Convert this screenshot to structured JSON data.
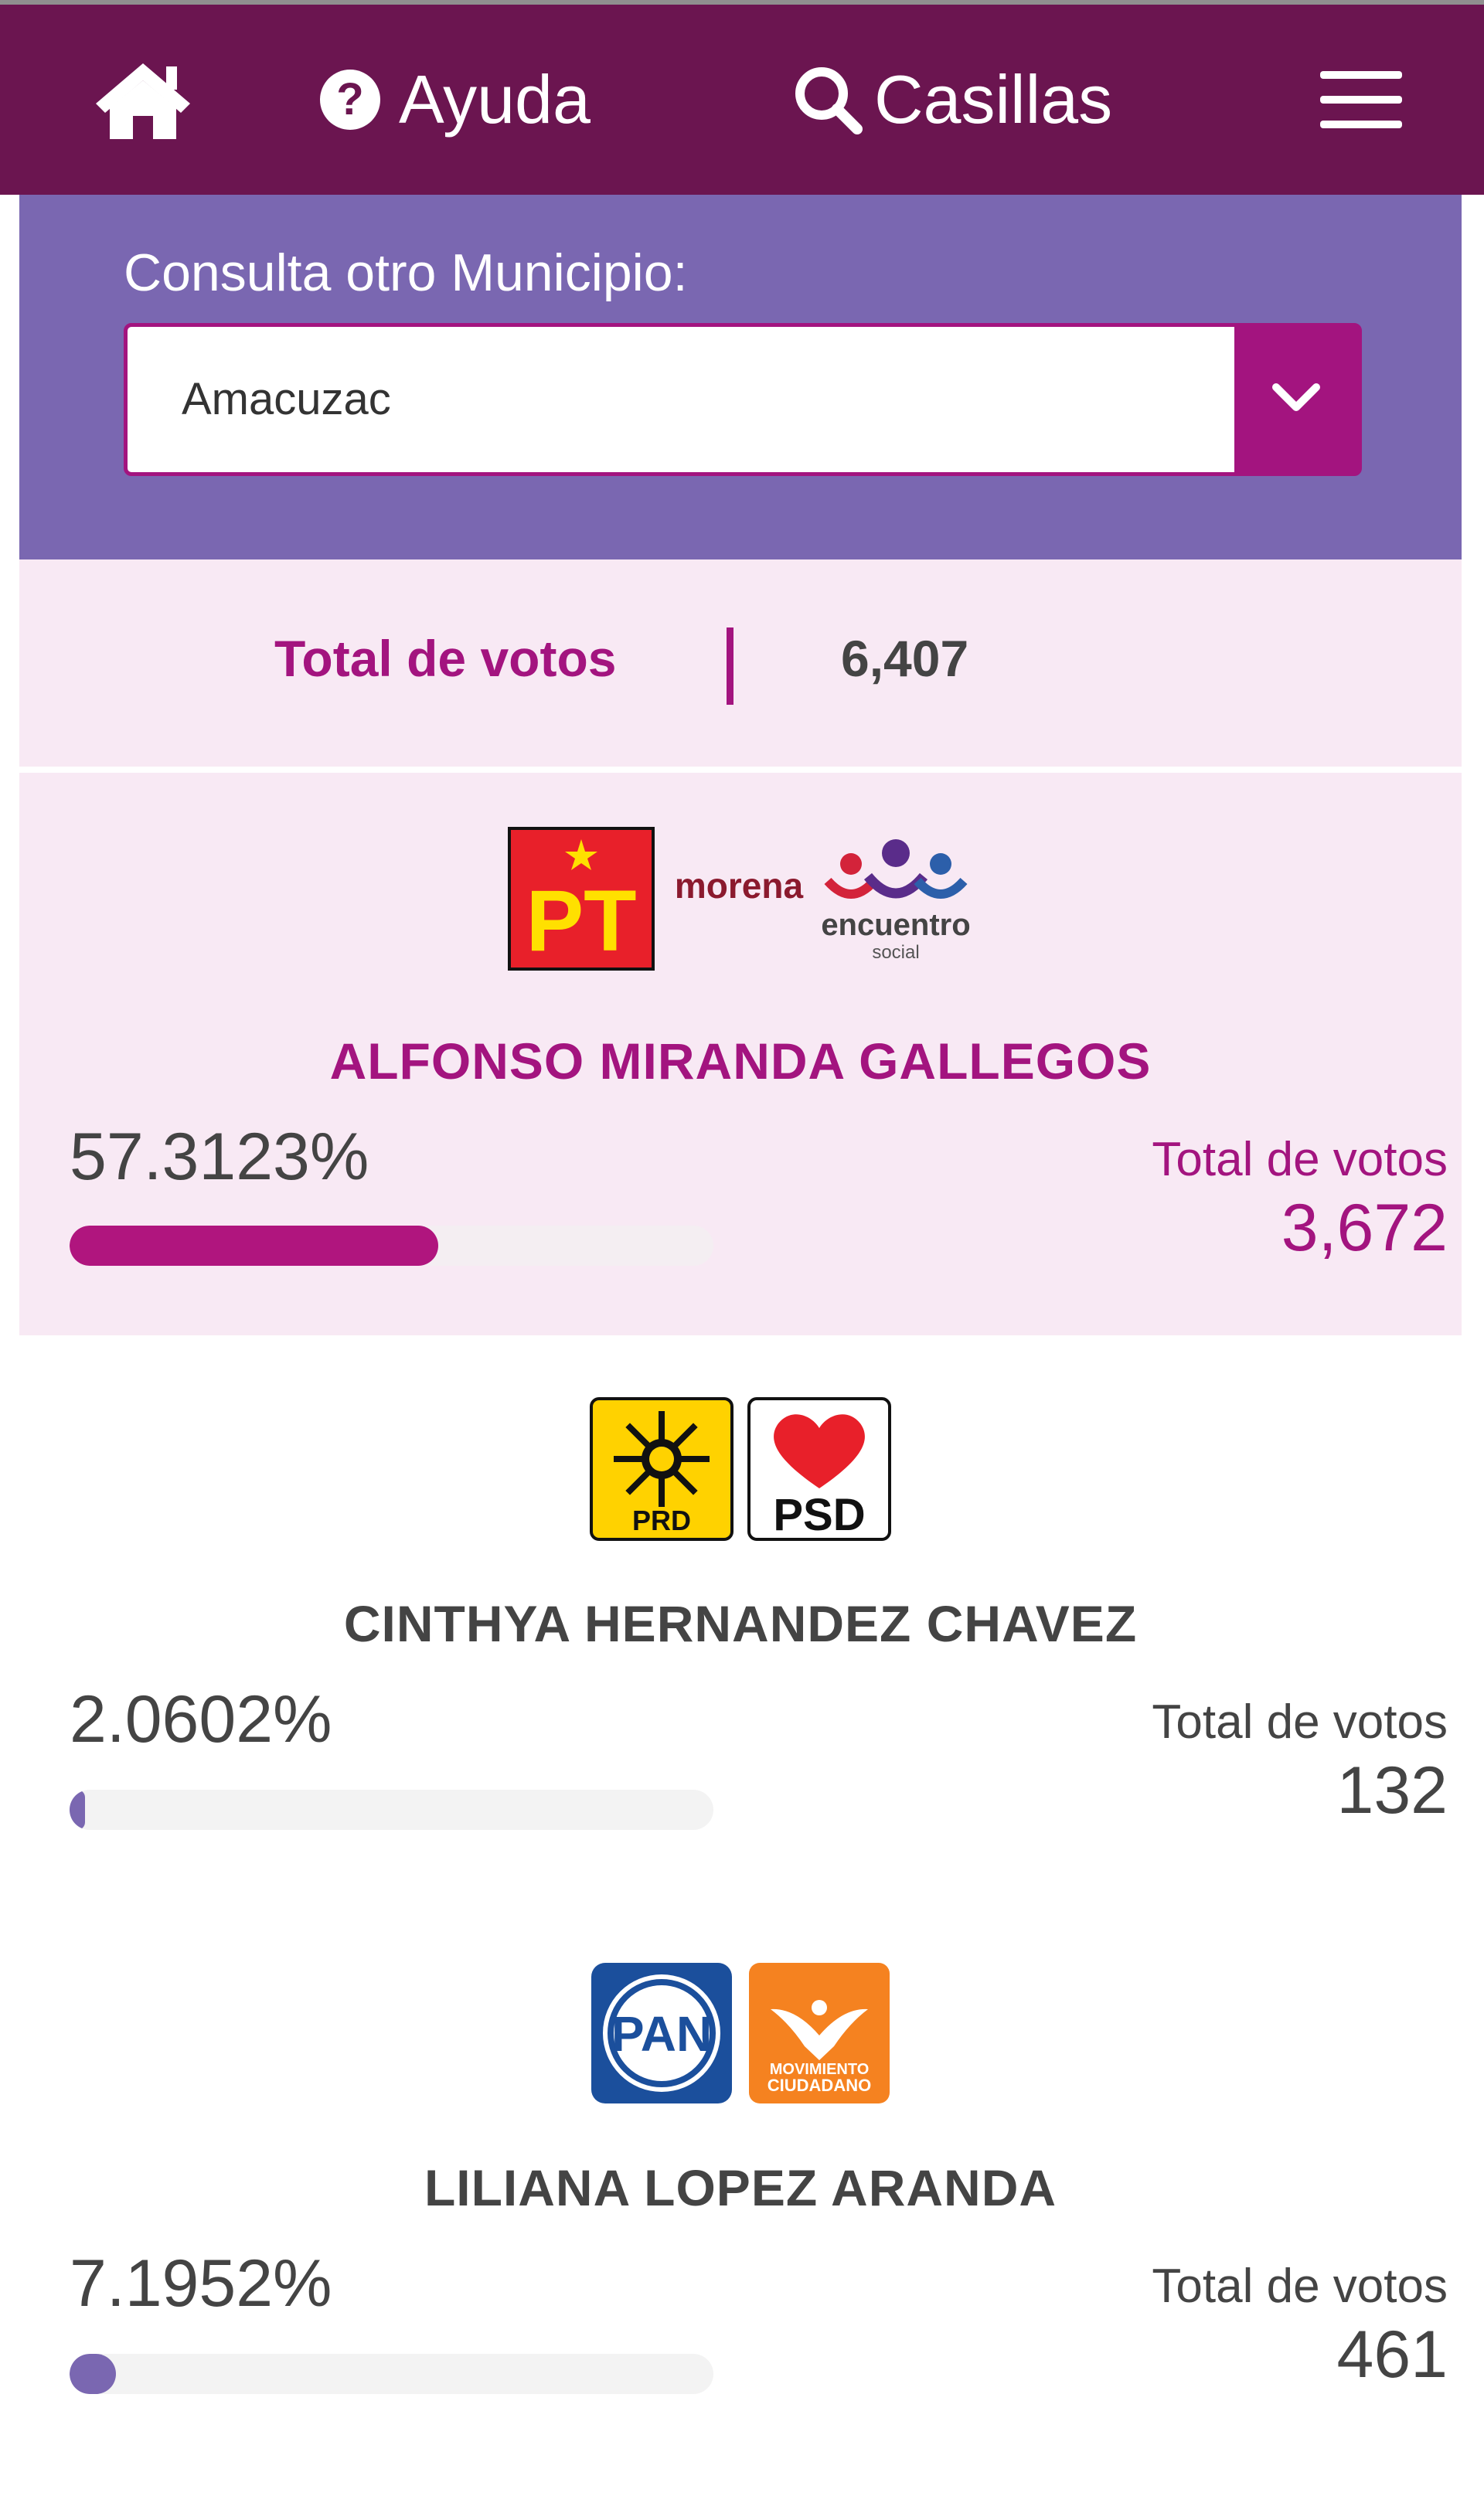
{
  "header": {
    "nav": [
      {
        "label": "",
        "icon": "home-icon"
      },
      {
        "label": "Ayuda",
        "icon": "help-icon"
      },
      {
        "label": "Casillas",
        "icon": "search-icon"
      },
      {
        "label": "",
        "icon": "menu-icon"
      }
    ]
  },
  "municipio": {
    "label": "Consulta otro Municipio:",
    "selected": "Amacuzac"
  },
  "summary": {
    "total_label": "Total de votos",
    "total_value": "6,407"
  },
  "candidates": [
    {
      "name": "ALFONSO MIRANDA GALLEGOS",
      "percent_text": "57.3123%",
      "percent": 57.3123,
      "votes_label": "Total de votos",
      "votes": "3,672",
      "bar_color": "#b0157e",
      "name_color": "#a3147f",
      "parties": [
        "PT",
        "morena",
        "encuentro",
        "social"
      ]
    },
    {
      "name": "CINTHYA HERNANDEZ CHAVEZ",
      "percent_text": "2.0602%",
      "percent": 2.0602,
      "votes_label": "Total de votos",
      "votes": "132",
      "bar_color": "#7a67b1",
      "name_color": "#444444",
      "parties": [
        "PRD",
        "PSD"
      ]
    },
    {
      "name": "LILIANA LOPEZ ARANDA",
      "percent_text": "7.1952%",
      "percent": 7.1952,
      "votes_label": "Total de votos",
      "votes": "461",
      "bar_color": "#7a67b1",
      "name_color": "#444444",
      "parties": [
        "PAN",
        "MOVIMIENTO",
        "CIUDADANO"
      ]
    }
  ],
  "colors": {
    "header_bg": "#6b1550",
    "panel_bg": "#7a67b1",
    "accent": "#a3147f",
    "highlight_bg": "#f8e9f4"
  }
}
